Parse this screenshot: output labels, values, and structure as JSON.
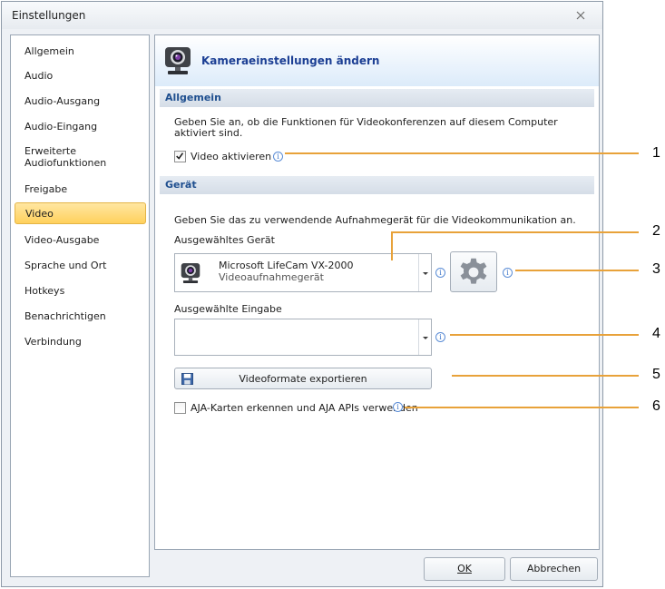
{
  "window": {
    "title": "Einstellungen"
  },
  "sidebar": {
    "items": [
      {
        "label": "Allgemein"
      },
      {
        "label": "Audio"
      },
      {
        "label": "Audio-Ausgang"
      },
      {
        "label": "Audio-Eingang"
      },
      {
        "label": "Erweiterte Audiofunktionen"
      },
      {
        "label": "Freigabe"
      },
      {
        "label": "Video",
        "selected": true
      },
      {
        "label": "Video-Ausgabe"
      },
      {
        "label": "Sprache und Ort"
      },
      {
        "label": "Hotkeys"
      },
      {
        "label": "Benachrichtigen"
      },
      {
        "label": "Verbindung"
      }
    ]
  },
  "header": {
    "title": "Kameraeinstellungen ändern",
    "icon": "webcam-icon"
  },
  "sections": {
    "general": {
      "title": "Allgemein",
      "description": "Geben Sie an, ob die Funktionen für Videokonferenzen auf diesem Computer aktiviert sind.",
      "enable_video": {
        "label": "Video aktivieren",
        "checked": true
      }
    },
    "device": {
      "title": "Gerät",
      "description": "Geben Sie das zu verwendende Aufnahmegerät für die Videokommunikation an.",
      "selected_device_label": "Ausgewähltes Gerät",
      "selected_device": {
        "name": "Microsoft LifeCam VX-2000",
        "type": "Videoaufnahmegerät"
      },
      "selected_input_label": "Ausgewählte Eingabe",
      "selected_input_value": "",
      "export_button": "Videoformate exportieren",
      "aja": {
        "label": "AJA-Karten erkennen und AJA APIs verwenden",
        "checked": false
      }
    }
  },
  "footer": {
    "ok": "OK",
    "cancel": "Abbrechen"
  },
  "callouts": [
    "1",
    "2",
    "3",
    "4",
    "5",
    "6"
  ],
  "colors": {
    "accent_title": "#1c3f94",
    "selected_nav": "#ffd15c",
    "callout_line": "#e8a23a"
  }
}
